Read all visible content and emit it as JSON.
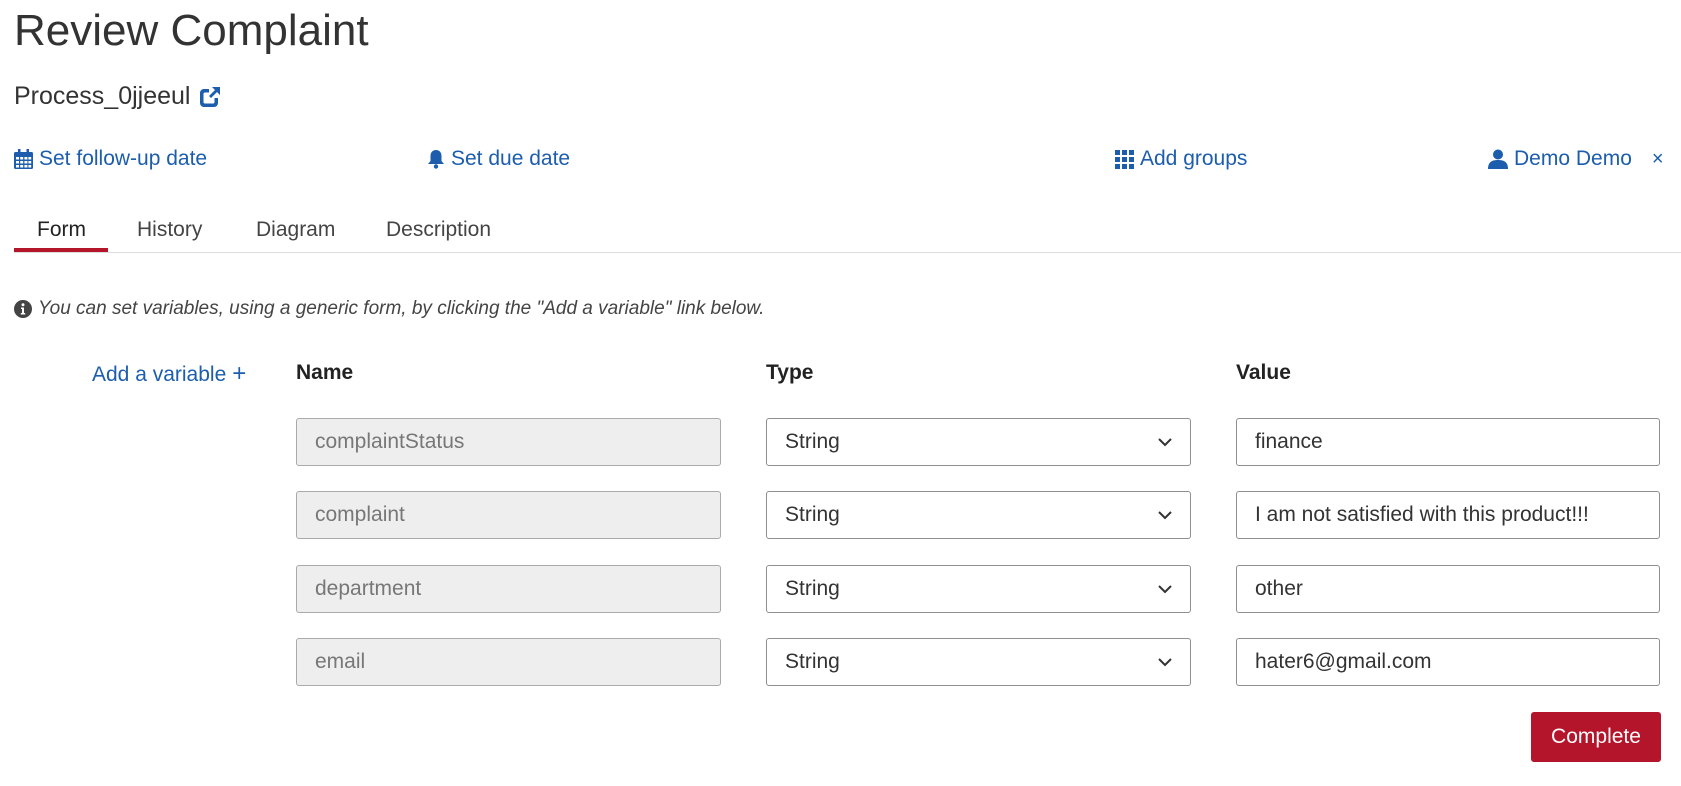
{
  "page": {
    "title": "Review Complaint",
    "process_name": "Process_0jjeeul"
  },
  "actions": {
    "follow_up": "Set follow-up date",
    "due_date": "Set due date",
    "groups": "Add groups",
    "assignee": "Demo Demo",
    "close_symbol": "×"
  },
  "tabs": [
    "Form",
    "History",
    "Diagram",
    "Description"
  ],
  "active_tab": "Form",
  "form": {
    "info_text": "You can set variables, using a generic form, by clicking the \"Add a variable\" link below.",
    "add_variable_label": "Add a variable",
    "add_variable_symbol": "+",
    "columns": {
      "name": "Name",
      "type": "Type",
      "value": "Value"
    },
    "variables": [
      {
        "name": "complaintStatus",
        "type": "String",
        "value": "finance"
      },
      {
        "name": "complaint",
        "type": "String",
        "value": "I am not satisfied with this product!!!"
      },
      {
        "name": "department",
        "type": "String",
        "value": "other"
      },
      {
        "name": "email",
        "type": "String",
        "value": "hater6@gmail.com"
      }
    ],
    "complete_label": "Complete"
  },
  "colors": {
    "link": "#1c5dad",
    "accent": "#b5152b",
    "text": "#333333"
  },
  "icons": {
    "process_link": "external-link-icon",
    "follow_up": "calendar-icon",
    "due_date": "bell-icon",
    "groups": "grid-icon",
    "assignee": "user-icon",
    "info": "info-circle-icon",
    "type_select": "chevron-down-icon"
  }
}
